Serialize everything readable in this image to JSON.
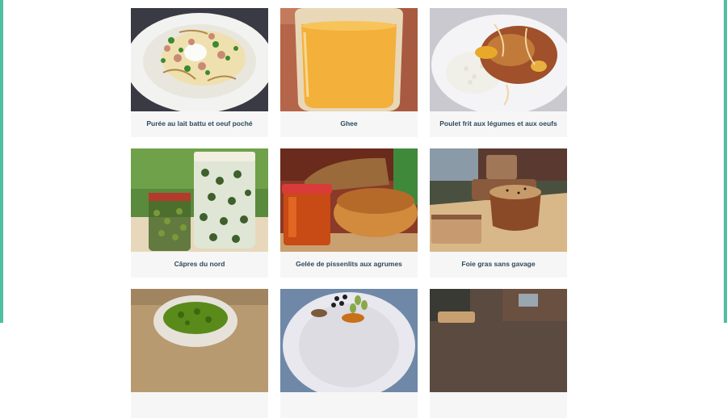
{
  "accent_color": "#4fbf9f",
  "caption_color": "#2d4a5c",
  "recipes": [
    {
      "title": "Purée au lait battu et oeuf poché",
      "image": "puree-egg-photo"
    },
    {
      "title": "Ghee",
      "image": "ghee-glass-photo"
    },
    {
      "title": "Poulet frit aux légumes et aux oeufs",
      "image": "fried-chicken-rice-photo"
    },
    {
      "title": "Câpres du nord",
      "image": "capers-jars-photo"
    },
    {
      "title": "Gelée de pissenlits aux agrumes",
      "image": "dandelion-jelly-bread-photo"
    },
    {
      "title": "Foie gras sans gavage",
      "image": "foie-gras-bread-photo"
    },
    {
      "title": "",
      "image": "green-pesto-bowl-photo"
    },
    {
      "title": "",
      "image": "spices-plate-photo"
    },
    {
      "title": "",
      "image": "bread-outdoor-photo"
    }
  ]
}
